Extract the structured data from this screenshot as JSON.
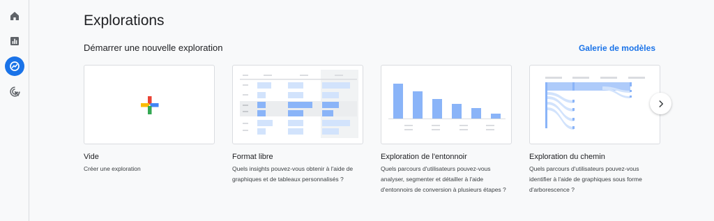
{
  "nav": {
    "items": [
      {
        "name": "home-icon",
        "active": false
      },
      {
        "name": "reports-icon",
        "active": false
      },
      {
        "name": "explore-icon",
        "active": true
      },
      {
        "name": "advertising-icon",
        "active": false
      }
    ]
  },
  "page": {
    "title": "Explorations",
    "subtitle": "Démarrer une nouvelle exploration",
    "gallery_link": "Galerie de modèles"
  },
  "cards": [
    {
      "title": "Vide",
      "description": "Créer une exploration",
      "thumbnail": "plus-icon"
    },
    {
      "title": "Format libre",
      "description": "Quels insights pouvez-vous obtenir à l'aide de graphiques et de tableaux personnalisés ?",
      "thumbnail": "table-thumbnail"
    },
    {
      "title": "Exploration de l'entonnoir",
      "description": "Quels parcours d'utilisateurs pouvez-vous analyser, segmenter et détailler à l'aide d'entonnoirs de conversion à plusieurs étapes ?",
      "thumbnail": "funnel-thumbnail"
    },
    {
      "title": "Exploration du chemin",
      "description": "Quels parcours d'utilisateurs pouvez-vous identifier à l'aide de graphiques sous forme d'arborescence ?",
      "thumbnail": "path-thumbnail"
    }
  ],
  "colors": {
    "accent": "#1a73e8",
    "thumb_blue": "#8ab4f8",
    "thumb_light": "#d2e3fc",
    "thumb_grey": "#dadce0"
  },
  "next_button": {
    "icon": "chevron-right-icon"
  }
}
